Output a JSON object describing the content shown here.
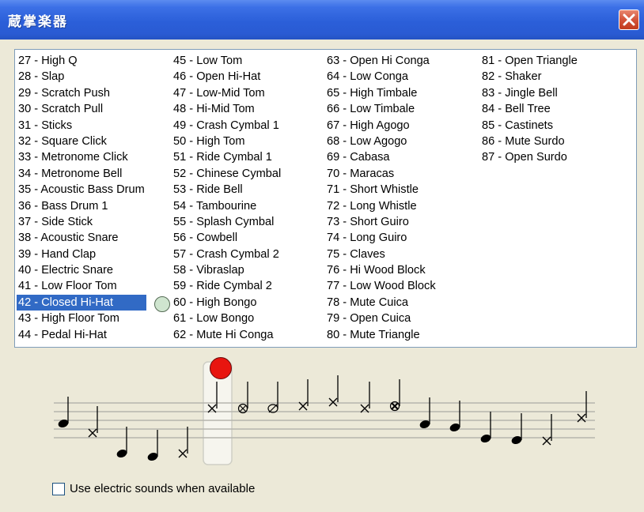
{
  "window": {
    "title": "蔵掌楽器",
    "close_icon": "close-x-icon"
  },
  "instruments": {
    "selected": "42 - Closed Hi-Hat",
    "columns": [
      [
        "27 - High Q",
        "28 - Slap",
        "29 - Scratch Push",
        "30 - Scratch Pull",
        "31 - Sticks",
        "32 - Square Click",
        "33 - Metronome Click",
        "34 - Metronome Bell",
        "35 - Acoustic Bass Drum",
        "36 - Bass Drum 1",
        "37 - Side Stick",
        "38 - Acoustic Snare",
        "39 - Hand Clap",
        "40 - Electric Snare",
        "41 - Low Floor Tom",
        "42 - Closed Hi-Hat",
        "43 - High Floor Tom",
        "44 - Pedal Hi-Hat"
      ],
      [
        "45 - Low Tom",
        "46 - Open Hi-Hat",
        "47 - Low-Mid Tom",
        "48 - Hi-Mid Tom",
        "49 - Crash Cymbal 1",
        "50 - High Tom",
        "51 - Ride Cymbal 1",
        "52 - Chinese Cymbal",
        "53 - Ride Bell",
        "54 - Tambourine",
        "55 - Splash Cymbal",
        "56 - Cowbell",
        "57 - Crash Cymbal 2",
        "58 - Vibraslap",
        "59 - Ride Cymbal 2",
        "60 - High Bongo",
        "61 - Low Bongo",
        "62 - Mute Hi Conga"
      ],
      [
        "63 - Open Hi Conga",
        "64 - Low Conga",
        "65 - High Timbale",
        "66 - Low Timbale",
        "67 - High Agogo",
        "68 - Low Agogo",
        "69 - Cabasa",
        "70 - Maracas",
        "71 - Short Whistle",
        "72 - Long Whistle",
        "73 - Short Guiro",
        "74 - Long Guiro",
        "75 - Claves",
        "76 - Hi Wood Block",
        "77 - Low Wood Block",
        "78 - Mute Cuica",
        "79 - Open Cuica",
        "80 - Mute Triangle"
      ],
      [
        "81 - Open Triangle",
        "82 - Shaker",
        "83 - Jingle Bell",
        "84 - Bell Tree",
        "85 - Castinets",
        "86 - Mute Surdo",
        "87 - Open Surdo"
      ]
    ]
  },
  "staff": {
    "notes": [
      {
        "head": "filled"
      },
      {
        "head": "x"
      },
      {
        "head": "filled"
      },
      {
        "head": "filled"
      },
      {
        "head": "x"
      },
      {
        "head": "x",
        "selected": true
      },
      {
        "head": "circle-x"
      },
      {
        "head": "slash-circle"
      },
      {
        "head": "x"
      },
      {
        "head": "x"
      },
      {
        "head": "x"
      },
      {
        "head": "circle-x-bold"
      },
      {
        "head": "filled"
      },
      {
        "head": "filled"
      },
      {
        "head": "filled"
      },
      {
        "head": "filled"
      },
      {
        "head": "x"
      },
      {
        "head": "x"
      }
    ]
  },
  "options": {
    "electric_label": "Use electric sounds when available",
    "electric_checked": false
  },
  "colors": {
    "selection": "#316ac5",
    "titlebar": "#2b5fd9",
    "record": "#e8150f"
  }
}
